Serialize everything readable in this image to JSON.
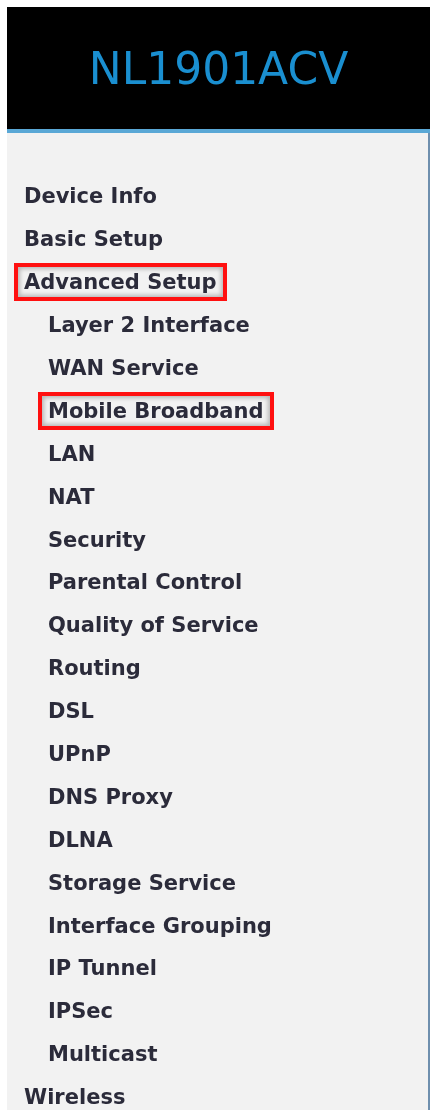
{
  "header": {
    "title": "NL1901ACV"
  },
  "menu": [
    {
      "label": "Device Info",
      "highlighted": false
    },
    {
      "label": "Basic Setup",
      "highlighted": false
    },
    {
      "label": "Advanced Setup",
      "highlighted": true,
      "children": [
        {
          "label": "Layer 2 Interface",
          "highlighted": false
        },
        {
          "label": "WAN Service",
          "highlighted": false
        },
        {
          "label": "Mobile Broadband",
          "highlighted": true
        },
        {
          "label": "LAN",
          "highlighted": false
        },
        {
          "label": "NAT",
          "highlighted": false
        },
        {
          "label": "Security",
          "highlighted": false
        },
        {
          "label": "Parental Control",
          "highlighted": false
        },
        {
          "label": "Quality of Service",
          "highlighted": false
        },
        {
          "label": "Routing",
          "highlighted": false
        },
        {
          "label": "DSL",
          "highlighted": false
        },
        {
          "label": "UPnP",
          "highlighted": false
        },
        {
          "label": "DNS Proxy",
          "highlighted": false
        },
        {
          "label": "DLNA",
          "highlighted": false
        },
        {
          "label": "Storage Service",
          "highlighted": false
        },
        {
          "label": "Interface Grouping",
          "highlighted": false
        },
        {
          "label": "IP Tunnel",
          "highlighted": false
        },
        {
          "label": "IPSec",
          "highlighted": false
        },
        {
          "label": "Multicast",
          "highlighted": false
        }
      ]
    },
    {
      "label": "Wireless",
      "highlighted": false
    }
  ]
}
